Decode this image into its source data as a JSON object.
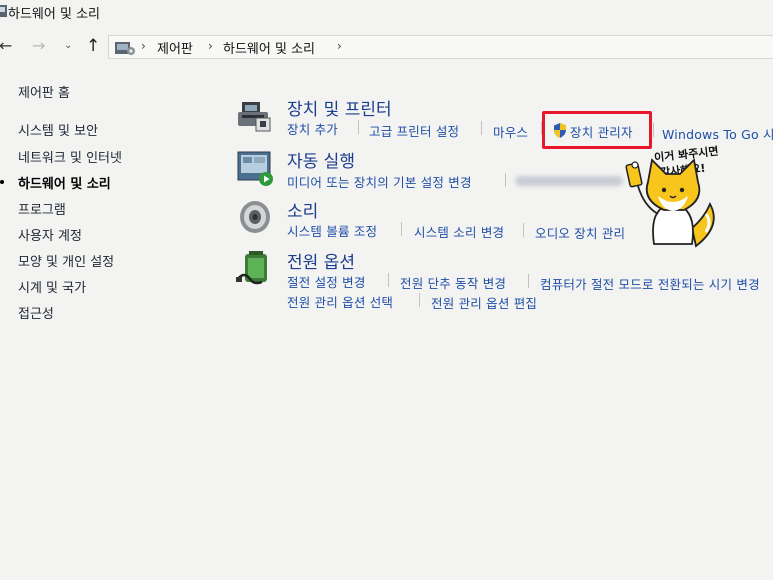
{
  "window": {
    "title": "하드웨어 및 소리"
  },
  "nav": {
    "back": "←",
    "forward": "→",
    "history": "⌄",
    "up": "↑"
  },
  "breadcrumb": {
    "items": [
      "제어판",
      "하드웨어 및 소리"
    ],
    "separator": "›"
  },
  "sidebar": {
    "home": "제어판 홈",
    "items": [
      "시스템 및 보안",
      "네트워크 및 인터넷",
      "하드웨어 및 소리",
      "프로그램",
      "사용자 계정",
      "모양 및 개인 설정",
      "시계 및 국가",
      "접근성"
    ],
    "current_index": 2
  },
  "categories": {
    "devices": {
      "title": "장치 및 프린터",
      "icon": "printer-icon",
      "links": [
        "장치 추가",
        "고급 프린터 설정",
        "마우스",
        "장치 관리자",
        "Windows To Go 시작"
      ]
    },
    "autoplay": {
      "title": "자동 실행",
      "icon": "autoplay-icon",
      "links": [
        "미디어 또는 장치의 기본 설정 변경"
      ]
    },
    "sound": {
      "title": "소리",
      "icon": "speaker-icon",
      "links": [
        "시스템 볼륨 조정",
        "시스템 소리 변경",
        "오디오 장치 관리"
      ]
    },
    "power": {
      "title": "전원 옵션",
      "icon": "battery-icon",
      "links": [
        "절전 설정 변경",
        "전원 단추 동작 변경",
        "컴퓨터가 절전 모드로 전환되는 시기 변경",
        "전원 관리 옵션 선택",
        "전원 관리 옵션 편집"
      ]
    }
  },
  "annotation": {
    "highlight_color": "#e8162a",
    "mascot_text": [
      "이거 봐주시면",
      "감사해요!"
    ]
  },
  "colors": {
    "link": "#1f4fa8",
    "title_link": "#1b3d8f",
    "background": "#f3f3f1"
  }
}
